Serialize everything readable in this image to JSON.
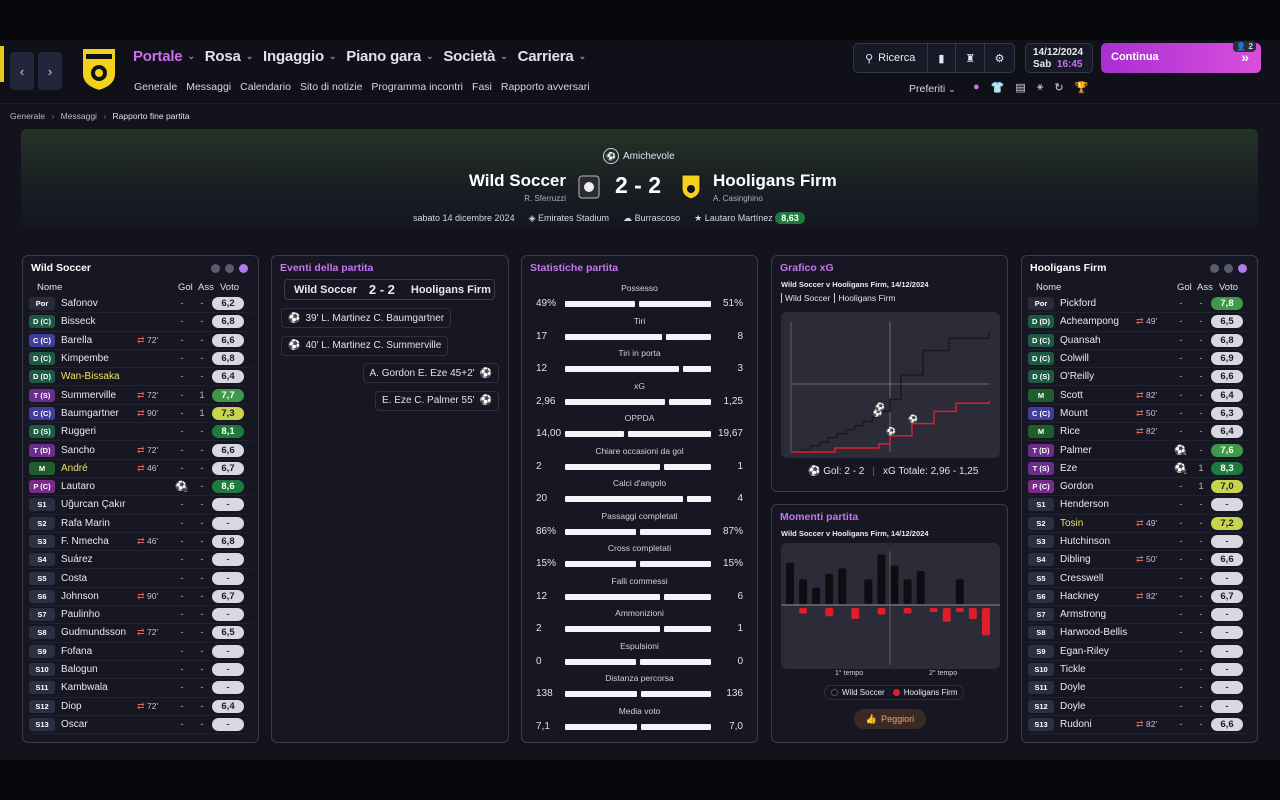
{
  "nav": {
    "back": "‹",
    "forward": "›",
    "main": [
      {
        "label": "Portale",
        "active": true
      },
      {
        "label": "Rosa",
        "active": false
      },
      {
        "label": "Ingaggio",
        "active": false
      },
      {
        "label": "Piano gara",
        "active": false
      },
      {
        "label": "Società",
        "active": false
      },
      {
        "label": "Carriera",
        "active": false
      }
    ],
    "sub": [
      "Generale",
      "Messaggi",
      "Calendario",
      "Sito di notizie",
      "Programma incontri",
      "Fasi",
      "Rapporto avversari"
    ],
    "search": "Ricerca",
    "date": "14/12/2024",
    "day": "Sab",
    "time": "16:45",
    "continue": "Continua",
    "continue_badge": "2",
    "favourites": "Preferiti"
  },
  "breadcrumb": [
    "Generale",
    "Messaggi",
    "Rapporto fine partita"
  ],
  "match": {
    "competition": "Amichevole",
    "home": "Wild Soccer",
    "home_coach": "R. Sferruzzi",
    "away": "Hooligans Firm",
    "away_coach": "A. Casinghino",
    "score": "2 - 2",
    "date": "sabato 14 dicembre 2024",
    "stadium": "Emirates Stadium",
    "weather": "Burrascoso",
    "potm": "Lautaro Martínez",
    "potm_rating": "8,63"
  },
  "home_panel": {
    "title": "Wild Soccer",
    "headers": {
      "name": "Nome",
      "gol": "Gol",
      "ass": "Ass",
      "voto": "Voto"
    },
    "players": [
      {
        "pos": "Por",
        "name": "Safonov",
        "sub": "",
        "gol": "-",
        "ass": "-",
        "voto": "6,2"
      },
      {
        "pos": "D (C)",
        "name": "Bisseck",
        "sub": "",
        "gol": "-",
        "ass": "-",
        "voto": "6,8"
      },
      {
        "pos": "C (C)",
        "name": "Barella",
        "sub": "72'",
        "gol": "-",
        "ass": "-",
        "voto": "6,6"
      },
      {
        "pos": "D (C)",
        "name": "Kimpembe",
        "sub": "",
        "gol": "-",
        "ass": "-",
        "voto": "6,8"
      },
      {
        "pos": "D (D)",
        "name": "Wan-Bissaka",
        "sub": "",
        "gol": "-",
        "ass": "-",
        "voto": "6,4",
        "hl": true
      },
      {
        "pos": "T (S)",
        "name": "Summerville",
        "sub": "72'",
        "gol": "-",
        "ass": "1",
        "voto": "7,7"
      },
      {
        "pos": "C (C)",
        "name": "Baumgartner",
        "sub": "90'",
        "gol": "-",
        "ass": "1",
        "voto": "7,3"
      },
      {
        "pos": "D (S)",
        "name": "Ruggeri",
        "sub": "",
        "gol": "-",
        "ass": "-",
        "voto": "8,1"
      },
      {
        "pos": "T (D)",
        "name": "Sancho",
        "sub": "72'",
        "gol": "-",
        "ass": "-",
        "voto": "6,6"
      },
      {
        "pos": "M",
        "name": "André",
        "sub": "46'",
        "gol": "-",
        "ass": "-",
        "voto": "6,7",
        "hl": true
      },
      {
        "pos": "P (C)",
        "name": "Lautaro",
        "sub": "",
        "gol": "2",
        "ass": "-",
        "voto": "8,6"
      },
      {
        "pos": "S1",
        "name": "Uğurcan Çakır",
        "sub": "",
        "gol": "-",
        "ass": "-",
        "voto": "-"
      },
      {
        "pos": "S2",
        "name": "Rafa Marin",
        "sub": "",
        "gol": "-",
        "ass": "-",
        "voto": "-"
      },
      {
        "pos": "S3",
        "name": "F. Nmecha",
        "sub": "46'",
        "gol": "-",
        "ass": "-",
        "voto": "6,8"
      },
      {
        "pos": "S4",
        "name": "Suárez",
        "sub": "",
        "gol": "-",
        "ass": "-",
        "voto": "-"
      },
      {
        "pos": "S5",
        "name": "Costa",
        "sub": "",
        "gol": "-",
        "ass": "-",
        "voto": "-"
      },
      {
        "pos": "S6",
        "name": "Johnson",
        "sub": "90'",
        "gol": "-",
        "ass": "-",
        "voto": "6,7"
      },
      {
        "pos": "S7",
        "name": "Paulinho",
        "sub": "",
        "gol": "-",
        "ass": "-",
        "voto": "-"
      },
      {
        "pos": "S8",
        "name": "Gudmundsson",
        "sub": "72'",
        "gol": "-",
        "ass": "-",
        "voto": "6,5"
      },
      {
        "pos": "S9",
        "name": "Fofana",
        "sub": "",
        "gol": "-",
        "ass": "-",
        "voto": "-"
      },
      {
        "pos": "S10",
        "name": "Balogun",
        "sub": "",
        "gol": "-",
        "ass": "-",
        "voto": "-"
      },
      {
        "pos": "S11",
        "name": "Kambwala",
        "sub": "",
        "gol": "-",
        "ass": "-",
        "voto": "-"
      },
      {
        "pos": "S12",
        "name": "Diop",
        "sub": "72'",
        "gol": "-",
        "ass": "-",
        "voto": "6,4"
      },
      {
        "pos": "S13",
        "name": "Oscar",
        "sub": "",
        "gol": "-",
        "ass": "-",
        "voto": "-"
      }
    ]
  },
  "away_panel": {
    "title": "Hooligans Firm",
    "headers": {
      "name": "Nome",
      "gol": "Gol",
      "ass": "Ass",
      "voto": "Voto"
    },
    "players": [
      {
        "pos": "Por",
        "name": "Pickford",
        "sub": "",
        "gol": "-",
        "ass": "-",
        "voto": "7,8"
      },
      {
        "pos": "D (D)",
        "name": "Acheampong",
        "sub": "49'",
        "gol": "-",
        "ass": "-",
        "voto": "6,5"
      },
      {
        "pos": "D (C)",
        "name": "Quansah",
        "sub": "",
        "gol": "-",
        "ass": "-",
        "voto": "6,8"
      },
      {
        "pos": "D (C)",
        "name": "Colwill",
        "sub": "",
        "gol": "-",
        "ass": "-",
        "voto": "6,9"
      },
      {
        "pos": "D (S)",
        "name": "O'Reilly",
        "sub": "",
        "gol": "-",
        "ass": "-",
        "voto": "6,6"
      },
      {
        "pos": "M",
        "name": "Scott",
        "sub": "82'",
        "gol": "-",
        "ass": "-",
        "voto": "6,4"
      },
      {
        "pos": "C (C)",
        "name": "Mount",
        "sub": "50'",
        "gol": "-",
        "ass": "-",
        "voto": "6,3"
      },
      {
        "pos": "M",
        "name": "Rice",
        "sub": "82'",
        "gol": "-",
        "ass": "-",
        "voto": "6,4"
      },
      {
        "pos": "T (D)",
        "name": "Palmer",
        "sub": "",
        "gol": "1",
        "ass": "-",
        "voto": "7,6"
      },
      {
        "pos": "T (S)",
        "name": "Eze",
        "sub": "",
        "gol": "1",
        "ass": "1",
        "voto": "8,3"
      },
      {
        "pos": "P (C)",
        "name": "Gordon",
        "sub": "",
        "gol": "-",
        "ass": "1",
        "voto": "7,0"
      },
      {
        "pos": "S1",
        "name": "Henderson",
        "sub": "",
        "gol": "-",
        "ass": "-",
        "voto": "-"
      },
      {
        "pos": "S2",
        "name": "Tosin",
        "sub": "49'",
        "gol": "-",
        "ass": "-",
        "voto": "7,2",
        "hl": true
      },
      {
        "pos": "S3",
        "name": "Hutchinson",
        "sub": "",
        "gol": "-",
        "ass": "-",
        "voto": "-"
      },
      {
        "pos": "S4",
        "name": "Dibling",
        "sub": "50'",
        "gol": "-",
        "ass": "-",
        "voto": "6,6"
      },
      {
        "pos": "S5",
        "name": "Cresswell",
        "sub": "",
        "gol": "-",
        "ass": "-",
        "voto": "-"
      },
      {
        "pos": "S6",
        "name": "Hackney",
        "sub": "82'",
        "gol": "-",
        "ass": "-",
        "voto": "6,7"
      },
      {
        "pos": "S7",
        "name": "Armstrong",
        "sub": "",
        "gol": "-",
        "ass": "-",
        "voto": "-"
      },
      {
        "pos": "S8",
        "name": "Harwood-Bellis",
        "sub": "",
        "gol": "-",
        "ass": "-",
        "voto": "-"
      },
      {
        "pos": "S9",
        "name": "Egan-Riley",
        "sub": "",
        "gol": "-",
        "ass": "-",
        "voto": "-"
      },
      {
        "pos": "S10",
        "name": "Tickle",
        "sub": "",
        "gol": "-",
        "ass": "-",
        "voto": "-"
      },
      {
        "pos": "S11",
        "name": "Doyle",
        "sub": "",
        "gol": "-",
        "ass": "-",
        "voto": "-"
      },
      {
        "pos": "S12",
        "name": "Doyle",
        "sub": "",
        "gol": "-",
        "ass": "-",
        "voto": "-"
      },
      {
        "pos": "S13",
        "name": "Rudoni",
        "sub": "82'",
        "gol": "-",
        "ass": "-",
        "voto": "6,6"
      }
    ]
  },
  "events": {
    "title": "Eventi della partita",
    "home": "Wild Soccer",
    "score": "2 - 2",
    "away": "Hooligans Firm",
    "items": [
      {
        "side": "home",
        "text": "39'  L. Martinez  C. Baumgartner"
      },
      {
        "side": "home",
        "text": "40'  L. Martinez  C. Summerville"
      },
      {
        "side": "away",
        "text": "A. Gordon  E. Eze  45+2'"
      },
      {
        "side": "away",
        "text": "E. Eze  C. Palmer  55'"
      }
    ]
  },
  "stats": {
    "title": "Statistiche partita",
    "rows": [
      {
        "label": "Possesso",
        "home": "49%",
        "away": "51%",
        "h": 49,
        "a": 51
      },
      {
        "label": "Tiri",
        "home": "17",
        "away": "8",
        "h": 17,
        "a": 8
      },
      {
        "label": "Tiri in porta",
        "home": "12",
        "away": "3",
        "h": 12,
        "a": 3
      },
      {
        "label": "xG",
        "home": "2,96",
        "away": "1,25",
        "h": 2.96,
        "a": 1.25
      },
      {
        "label": "OPPDA",
        "home": "14,00",
        "away": "19,67",
        "h": 14.0,
        "a": 19.67
      },
      {
        "label": "Chiare occasioni da gol",
        "home": "2",
        "away": "1",
        "h": 2,
        "a": 1
      },
      {
        "label": "Calci d'angolo",
        "home": "20",
        "away": "4",
        "h": 20,
        "a": 4
      },
      {
        "label": "Passaggi completati",
        "home": "86%",
        "away": "87%",
        "h": 86,
        "a": 87
      },
      {
        "label": "Cross completati",
        "home": "15%",
        "away": "15%",
        "h": 15,
        "a": 15
      },
      {
        "label": "Falli commessi",
        "home": "12",
        "away": "6",
        "h": 12,
        "a": 6
      },
      {
        "label": "Ammonizioni",
        "home": "2",
        "away": "1",
        "h": 2,
        "a": 1
      },
      {
        "label": "Espulsioni",
        "home": "0",
        "away": "0",
        "h": 0,
        "a": 0
      },
      {
        "label": "Distanza percorsa",
        "home": "138",
        "away": "136",
        "h": 138,
        "a": 136
      },
      {
        "label": "Media voto",
        "home": "7,1",
        "away": "7,0",
        "h": 7.1,
        "a": 7.0
      }
    ]
  },
  "xg_panel": {
    "title": "Grafico xG",
    "subtitle": "Wild Soccer v Hooligans Firm, 14/12/2024",
    "tab_home": "Wild Soccer",
    "tab_away": "Hooligans Firm",
    "footer_goals": "Gol: 2 - 2",
    "footer_xg": "xG Totale: 2,96 - 1,25"
  },
  "moments_panel": {
    "title": "Momenti partita",
    "subtitle": "Wild Soccer v Hooligans Firm, 14/12/2024",
    "xlabel1": "1° tempo",
    "xlabel2": "2° tempo",
    "legend_home": "Wild Soccer",
    "legend_away": "Hooligans Firm",
    "button": "Peggiori"
  },
  "chart_data": [
    {
      "type": "line",
      "series": [
        {
          "name": "Wild Soccer",
          "color": "#1a1a1a",
          "x": [
            0,
            5,
            9,
            13,
            17,
            21,
            25,
            29,
            33,
            37,
            40,
            45,
            50,
            60,
            72,
            90
          ],
          "y": [
            0,
            0.05,
            0.15,
            0.25,
            0.35,
            0.45,
            0.55,
            0.65,
            0.75,
            0.85,
            1.0,
            1.3,
            1.9,
            2.5,
            2.8,
            2.96
          ]
        },
        {
          "name": "Hooligans Firm",
          "color": "#e01e2a",
          "x": [
            0,
            20,
            40,
            45,
            55,
            65,
            75,
            90
          ],
          "y": [
            0,
            0.1,
            0.2,
            0.4,
            0.7,
            1.0,
            1.2,
            1.25
          ]
        }
      ],
      "ylim": [
        0,
        3.2
      ],
      "xlim": [
        0,
        90
      ]
    },
    {
      "type": "bar",
      "series": [
        {
          "name": "Wild Soccer",
          "color": "#0e0e12",
          "values": [
            0.75,
            0.45,
            0.3,
            0.55,
            0.65,
            0.0,
            0.45,
            0.9,
            0.7,
            0.45,
            0.6,
            0.0,
            0.0,
            0.45,
            0.0,
            0.0
          ]
        },
        {
          "name": "Hooligans Firm",
          "color": "#e01e2a",
          "values": [
            0.0,
            0.1,
            0.0,
            0.15,
            0.0,
            0.2,
            0.0,
            0.12,
            0.0,
            0.1,
            0.0,
            0.05,
            0.25,
            0.05,
            0.2,
            0.5
          ]
        }
      ]
    }
  ]
}
